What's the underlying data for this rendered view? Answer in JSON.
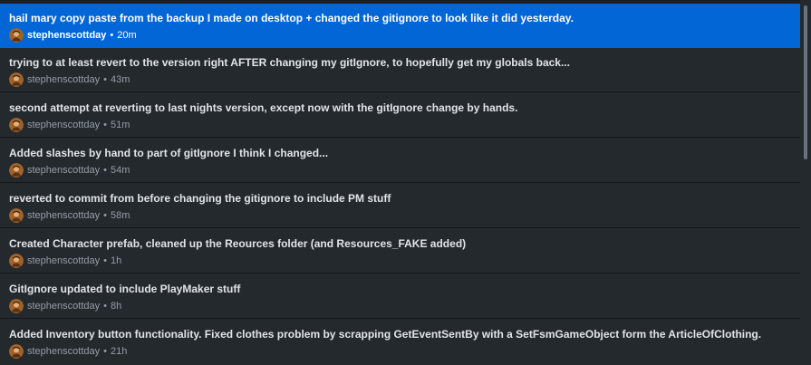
{
  "commits": [
    {
      "summary": "hail mary copy paste from the backup I made on desktop + changed the gitignore to look like it did yesterday.",
      "author": "stephenscottday",
      "separator": "•",
      "age": "20m",
      "selected": true
    },
    {
      "summary": "trying to at least revert to the version right AFTER changing my gitIgnore, to hopefully get my globals back...",
      "author": "stephenscottday",
      "separator": "•",
      "age": "43m",
      "selected": false
    },
    {
      "summary": "second attempt at reverting to last nights version, except now with the gitIgnore change by hands.",
      "author": "stephenscottday",
      "separator": "•",
      "age": "51m",
      "selected": false
    },
    {
      "summary": "Added slashes by hand to part of gitIgnore I think I changed...",
      "author": "stephenscottday",
      "separator": "•",
      "age": "54m",
      "selected": false
    },
    {
      "summary": "reverted to commit from before changing the gitignore to include PM stuff",
      "author": "stephenscottday",
      "separator": "•",
      "age": "58m",
      "selected": false
    },
    {
      "summary": "Created Character prefab, cleaned up the Reources folder (and Resources_FAKE added)",
      "author": "stephenscottday",
      "separator": "•",
      "age": "1h",
      "selected": false
    },
    {
      "summary": "GitIgnore updated to include PlayMaker stuff",
      "author": "stephenscottday",
      "separator": "•",
      "age": "8h",
      "selected": false
    },
    {
      "summary": "Added Inventory button functionality. Fixed clothes problem by scrapping GetEventSentBy with a SetFsmGameObject form the ArticleOfClothing.",
      "author": "stephenscottday",
      "separator": "•",
      "age": "21h",
      "selected": false
    }
  ],
  "avatar_icon": "user-avatar-icon",
  "colors": {
    "background": "#24292e",
    "selected_row": "#0366d6",
    "text": "#e1e4e8",
    "muted_text": "#959da5",
    "divider": "#141618",
    "scroll_thumb": "#6a737d"
  }
}
